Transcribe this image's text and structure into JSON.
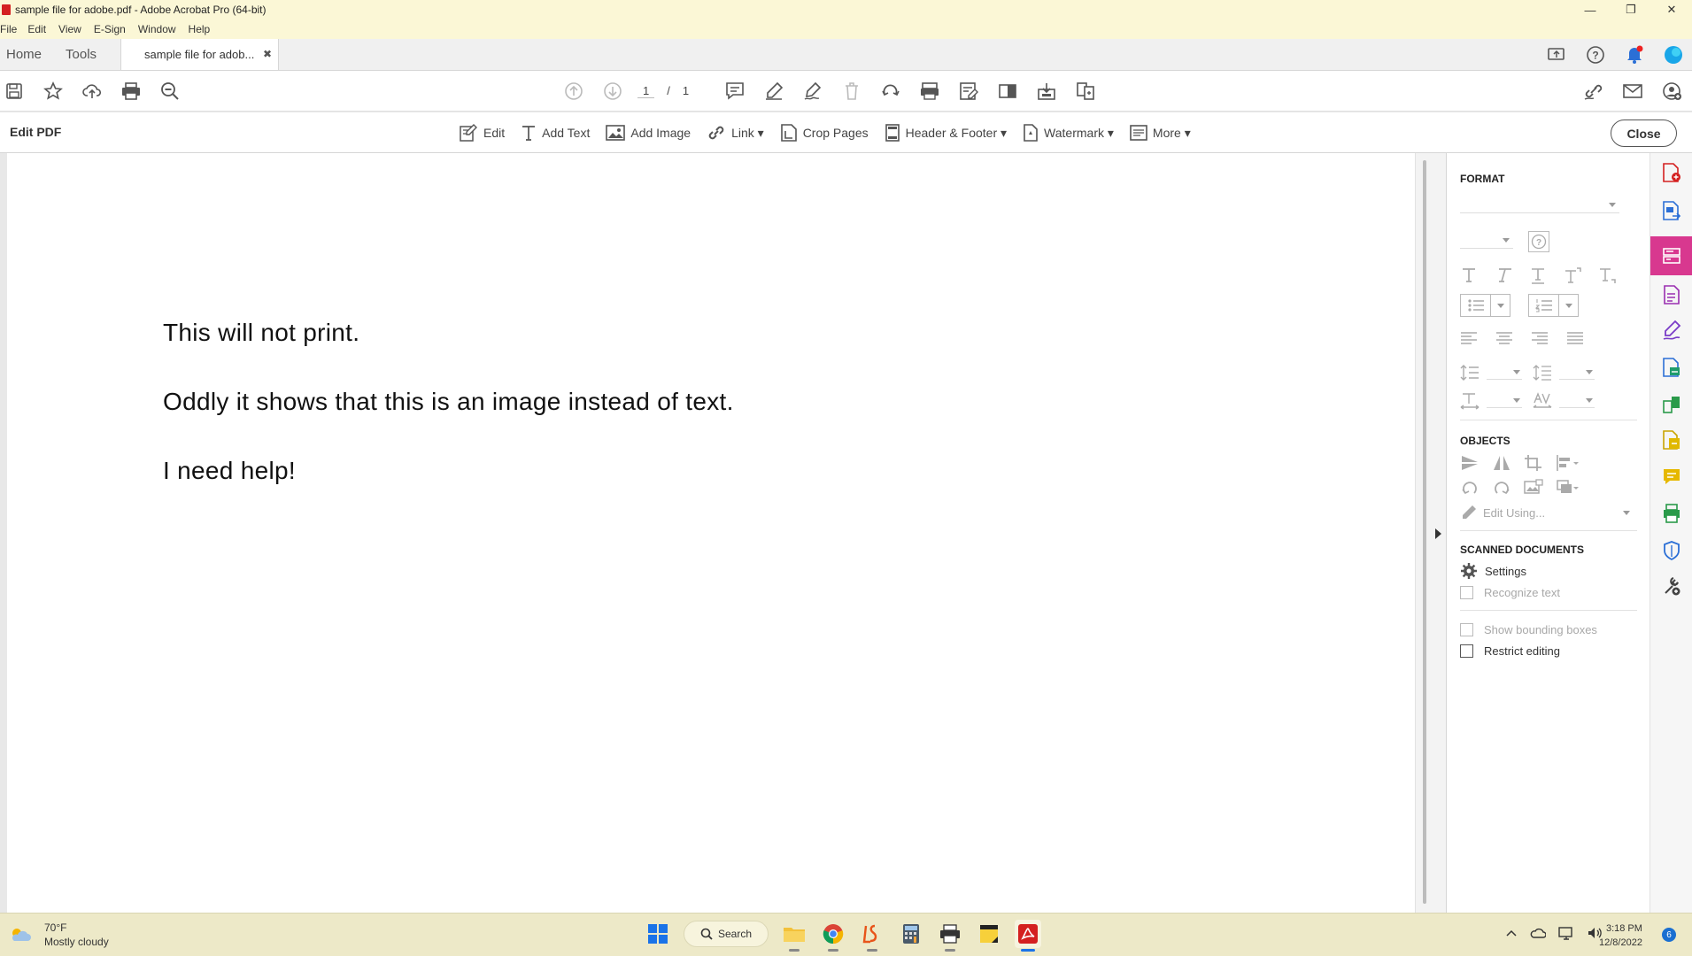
{
  "window": {
    "title": "sample file for adobe.pdf - Adobe Acrobat Pro (64-bit)",
    "controls": [
      "—",
      "❐",
      "✕"
    ]
  },
  "menu": [
    "File",
    "Edit",
    "View",
    "E-Sign",
    "Window",
    "Help"
  ],
  "tabs": {
    "home": "Home",
    "tools": "Tools",
    "document": "sample file for adob...",
    "close_glyph": "✖"
  },
  "toolbar": {
    "page_current": "1",
    "page_sep": "/",
    "page_total": "1"
  },
  "edit_bar": {
    "title": "Edit PDF",
    "tools": [
      "Edit",
      "Add Text",
      "Add Image",
      "Link ▾",
      "Crop Pages",
      "Header & Footer ▾",
      "Watermark ▾",
      "More ▾"
    ],
    "close_label": "Close"
  },
  "document": {
    "lines": [
      "This will not print.",
      "Oddly it shows that this is an image instead of text.",
      "I need help!"
    ]
  },
  "right_panel": {
    "format_heading": "FORMAT",
    "objects_heading": "OBJECTS",
    "edit_using": "Edit Using...",
    "scanned_heading": "SCANNED DOCUMENTS",
    "settings": "Settings",
    "recognize_text": "Recognize text",
    "show_bounding_boxes": "Show bounding boxes",
    "restrict_editing": "Restrict editing"
  },
  "colors": {
    "titlebar_bg": "#fbf7d6",
    "accent_pink": "#d8388f",
    "acrobat_red": "#d42020",
    "taskbar_bg": "#ede9c8"
  },
  "taskbar": {
    "temp": "70°F",
    "weather": "Mostly cloudy",
    "search": "Search",
    "time": "3:18 PM",
    "date": "12/8/2022",
    "notifications": "6"
  }
}
